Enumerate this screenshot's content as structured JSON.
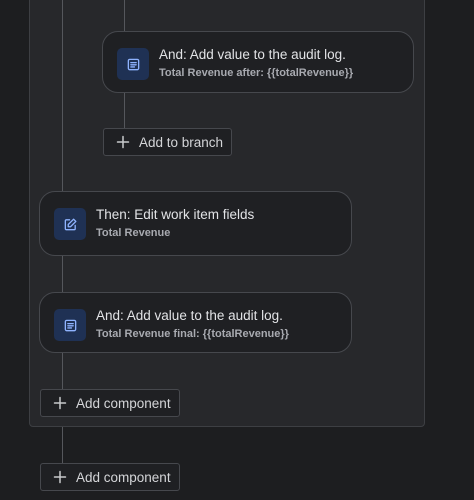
{
  "branch": {
    "audit_card": {
      "title": "And: Add value to the audit log.",
      "subtitle": "Total Revenue after: {{totalRevenue}}",
      "icon": "audit-log-icon"
    },
    "add_to_branch_label": "Add to branch"
  },
  "main": {
    "edit_card": {
      "title": "Then: Edit work item fields",
      "subtitle": "Total Revenue",
      "icon": "edit-icon"
    },
    "audit_card": {
      "title": "And: Add value to the audit log.",
      "subtitle": "Total Revenue final: {{totalRevenue}}",
      "icon": "audit-log-icon"
    },
    "inner_add_component_label": "Add component",
    "outer_add_component_label": "Add component"
  },
  "colors": {
    "background": "#1d1e20",
    "branch_panel": "#27282b",
    "card": "#1f2023",
    "icon_tile": "#1f3154",
    "icon_stroke": "#8fb3ff"
  }
}
